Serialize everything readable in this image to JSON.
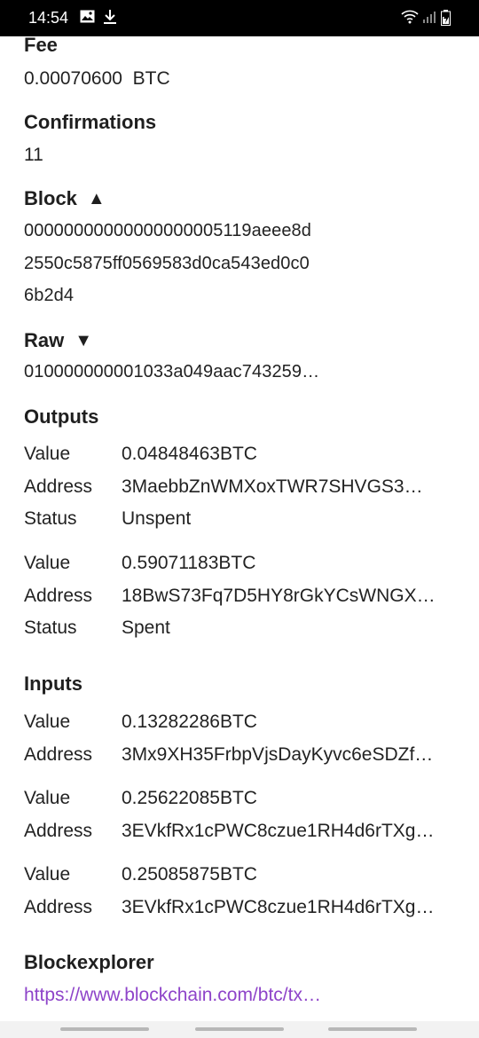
{
  "status_bar": {
    "time": "14:54"
  },
  "fee": {
    "label": "Fee",
    "value": "0.00070600",
    "unit": "BTC"
  },
  "confirmations": {
    "label": "Confirmations",
    "value": "11"
  },
  "block": {
    "label": "Block",
    "toggle": "▲",
    "lines": [
      "00000000000000000005119aeee8d",
      "2550c5875ff0569583d0ca543ed0c0",
      "6b2d4"
    ]
  },
  "raw": {
    "label": "Raw",
    "toggle": "▼",
    "value": "010000000001033a049aac743259…"
  },
  "outputs": {
    "label": "Outputs",
    "value_key": "Value",
    "address_key": "Address",
    "status_key": "Status",
    "items": [
      {
        "value": "0.04848463BTC",
        "address": "3MaebbZnWMXoxTWR7SHVGS3…",
        "status": "Unspent"
      },
      {
        "value": "0.59071183BTC",
        "address": "18BwS73Fq7D5HY8rGkYCsWNGX…",
        "status": "Spent"
      }
    ]
  },
  "inputs": {
    "label": "Inputs",
    "value_key": "Value",
    "address_key": "Address",
    "items": [
      {
        "value": "0.13282286BTC",
        "address": "3Mx9XH35FrbpVjsDayKyvc6eSDZf…"
      },
      {
        "value": "0.25622085BTC",
        "address": "3EVkfRx1cPWC8czue1RH4d6rTXg…"
      },
      {
        "value": "0.25085875BTC",
        "address": "3EVkfRx1cPWC8czue1RH4d6rTXg…"
      }
    ]
  },
  "blockexplorer": {
    "label": "Blockexplorer",
    "url": "https://www.blockchain.com/btc/tx…"
  }
}
